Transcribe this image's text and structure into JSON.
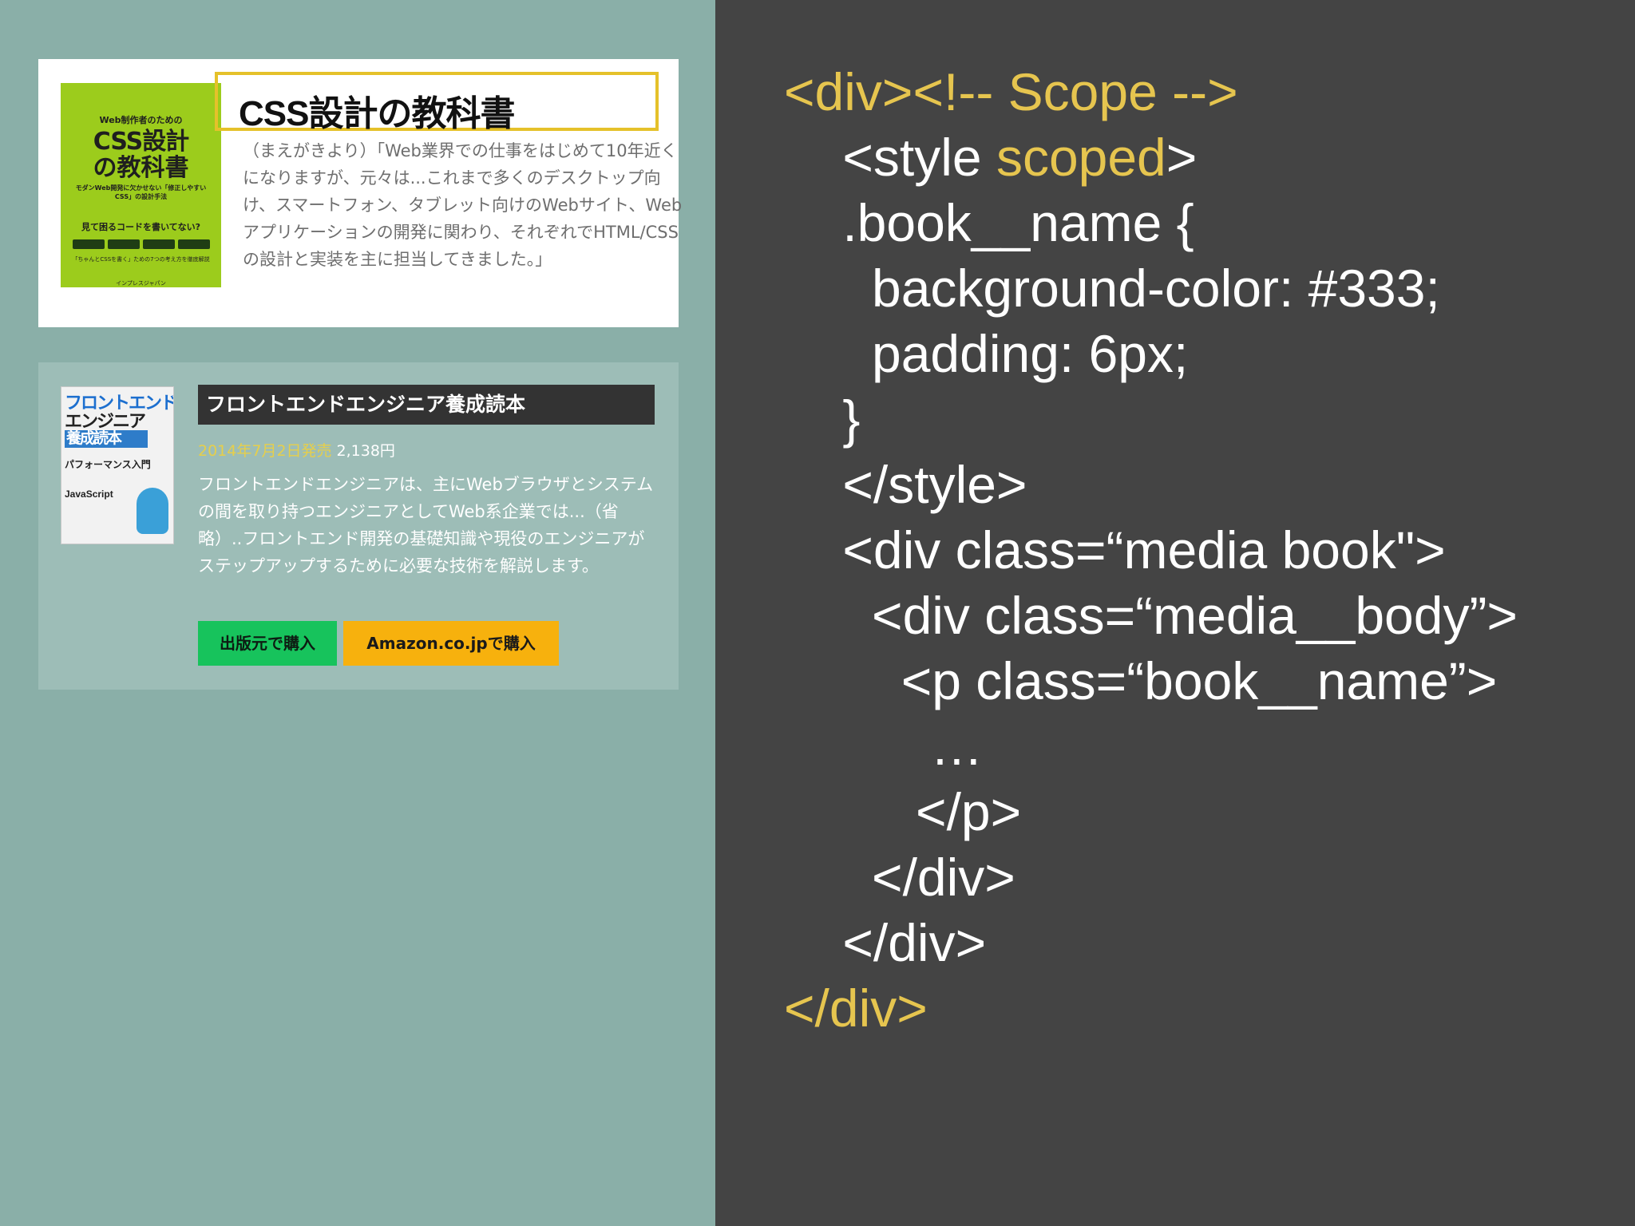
{
  "card1": {
    "cover": {
      "subtitle": "Web制作者のための",
      "title_line1": "CSS設計",
      "title_line2": "の教科書",
      "description": "モダンWeb開発に欠かせない「修正しやすいCSS」の設計手法",
      "question": "見て困るコードを書いてない?",
      "note": "「ちゃんとCSSを書く」ための7つの考え方を徹底解説",
      "publisher": "インプレスジャパン"
    },
    "title": "CSS設計の教科書",
    "description": "（まえがきより）「Web業界での仕事をはじめて10年近くになりますが、元々は...これまで多くのデスクトップ向け、スマートフォン、タブレット向けのWebサイト、Webアプリケーションの開発に関わり、それぞれでHTML/CSSの設計と実装を主に担当してきました。」"
  },
  "card2": {
    "cover": {
      "line1": "フロントエンド",
      "line2": "エンジニア",
      "line3": "養成読本",
      "line4": "パフォーマンス入門",
      "line5": "JavaScript"
    },
    "title": "フロントエンドエンジニア養成読本",
    "release_date": "2014年7月2日発売",
    "price": "2,138円",
    "description": "フロントエンドエンジニアは、主にWebブラウザとシステムの間を取り持つエンジニアとしてWeb系企業では...（省略）..フロントエンド開発の基礎知識や現役のエンジニアがステップアップするために必要な技術を解説します。",
    "buy_publisher_label": "出版元で購入",
    "buy_amazon_label": "Amazon.co.jpで購入"
  },
  "code": {
    "l1": "<div><!-- Scope -->",
    "l2a": "    <style ",
    "l2b": "scoped",
    "l2c": ">",
    "l3": "    .book__name {",
    "l4": "      background-color: #333;",
    "l5": "      padding: 6px;",
    "l6": "    }",
    "l7": "    </style>",
    "l8": "    <div class=“media book\">",
    "l9": "      <div class=“media__body”>",
    "l10": "        <p class=“book__name”>",
    "l11": "          …",
    "l12": "         </p>",
    "l13": "      </div>",
    "l14": "    </div>",
    "l15": "</div>"
  },
  "colors": {
    "left_bg": "#8aafa8",
    "right_bg": "#444444",
    "highlight_yellow": "#e6c54f",
    "title_border": "#e5c12a",
    "button_green": "#17c35c",
    "button_orange": "#f7b10d"
  }
}
